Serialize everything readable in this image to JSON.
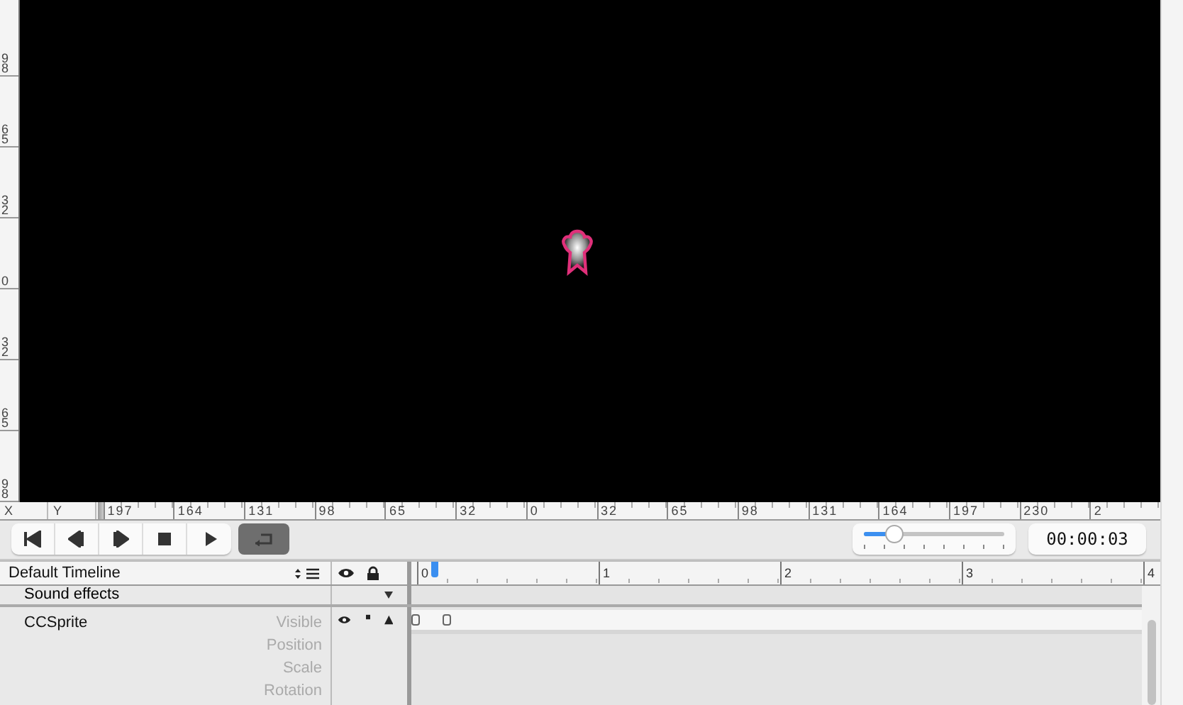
{
  "vertical_ruler": [
    "98",
    "65",
    "32",
    "0",
    "32",
    "65",
    "98"
  ],
  "horizontal_ruler": {
    "x_label": "X",
    "y_label": "Y",
    "ticks": [
      "197",
      "164",
      "131",
      "98",
      "65",
      "32",
      "0",
      "32",
      "65",
      "98",
      "131",
      "164",
      "197",
      "230",
      "2"
    ]
  },
  "transport": {
    "buttons": [
      {
        "kind": "first"
      },
      {
        "kind": "prev"
      },
      {
        "kind": "next"
      },
      {
        "kind": "stop"
      },
      {
        "kind": "play"
      }
    ],
    "loop": {
      "on": true
    }
  },
  "zoom_slider": {
    "level": 0.22
  },
  "time": "00:00:03",
  "timeline": {
    "name": "Default Timeline",
    "ruler": [
      "0",
      "1",
      "2",
      "3",
      "4"
    ],
    "sections": [
      {
        "name": "Sound effects"
      }
    ],
    "nodes": [
      {
        "name": "CCSprite",
        "visible": true,
        "properties": [
          "Visible",
          "Position",
          "Scale",
          "Rotation"
        ]
      }
    ]
  }
}
